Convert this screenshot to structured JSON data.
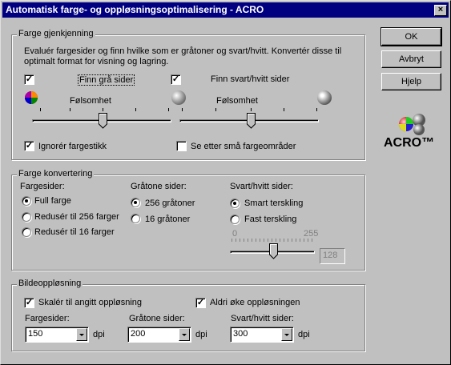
{
  "window": {
    "title": "Automatisk farge- og oppløsningsoptimalisering - ACRO",
    "close_glyph": "×"
  },
  "buttons": {
    "ok": "OK",
    "cancel": "Avbryt",
    "help": "Hjelp"
  },
  "logo": {
    "text": "ACRO™"
  },
  "color_detection": {
    "title": "Farge gjenkjenning",
    "description_line1": "Evaluér fargesider og finn hvilke som er gråtoner og svart/hvitt. Konvertér disse til",
    "description_line2": "optimalt format for visning og lagring.",
    "find_gray_label": "Finn grå sider",
    "find_bw_label": "Finn svart/hvitt sider",
    "sensitivity_label_left": "Følsomhet",
    "sensitivity_label_right": "Følsomhet",
    "ignore_color_cast_label": "Ignorér fargestikk",
    "small_color_areas_label": "Se etter små fargeområder",
    "find_gray_checked": true,
    "find_bw_checked": true,
    "ignore_color_cast_checked": true,
    "small_color_areas_checked": false,
    "sensitivity_left_level": 0.5,
    "sensitivity_right_level": 0.5,
    "check_glyph": "✓"
  },
  "color_conversion": {
    "title": "Farge konvertering",
    "color_pages_header": "Fargesider:",
    "color_options": [
      "Full farge",
      "Redusér til 256 farger",
      "Redusér til 16 farger"
    ],
    "color_selected": 0,
    "gray_pages_header": "Gråtone sider:",
    "gray_options": [
      "256 gråtoner",
      "16 gråtoner"
    ],
    "gray_selected": 0,
    "bw_pages_header": "Svart/hvitt sider:",
    "bw_options": [
      "Smart terskling",
      "Fast terskling"
    ],
    "bw_selected": 0,
    "threshold_min": "0",
    "threshold_max": "255",
    "threshold_value": "128"
  },
  "resolution": {
    "title": "Bildeoppløsning",
    "scale_label": "Skalér til angitt oppløsning",
    "never_increase_label": "Aldri øke oppløsningen",
    "scale_checked": true,
    "never_increase_checked": true,
    "color_pages_label": "Fargesider:",
    "gray_pages_label": "Gråtone sider:",
    "bw_pages_label": "Svart/hvitt sider:",
    "color_dpi": "150",
    "gray_dpi": "200",
    "bw_dpi": "300",
    "unit": "dpi"
  }
}
